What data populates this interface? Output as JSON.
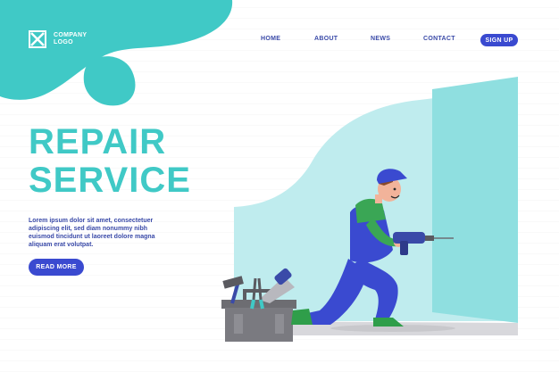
{
  "colors": {
    "accent": "#40c9c6",
    "primary": "#3a4ad0",
    "text": "#3a4aa8"
  },
  "logo": {
    "icon": "logo-x-icon",
    "line1": "COMPANY",
    "line2": "LOGO"
  },
  "nav": {
    "home": "HOME",
    "about": "ABOUT",
    "news": "NEWS",
    "contact": "CONTACT",
    "signup": "SIGN UP"
  },
  "hero": {
    "title_line1": "REPAIR",
    "title_line2": "SERVICE",
    "description": "Lorem ipsum dolor sit amet, consectetuer adipiscing elit, sed diam nonummy nibh euismod tincidunt ut laoreet dolore magna aliquam erat volutpat.",
    "cta": "READ MORE"
  },
  "illustration": {
    "subject": "repairman-drilling-wall",
    "props": [
      "toolbox",
      "hammer",
      "saw",
      "pliers",
      "electric-drill"
    ]
  }
}
